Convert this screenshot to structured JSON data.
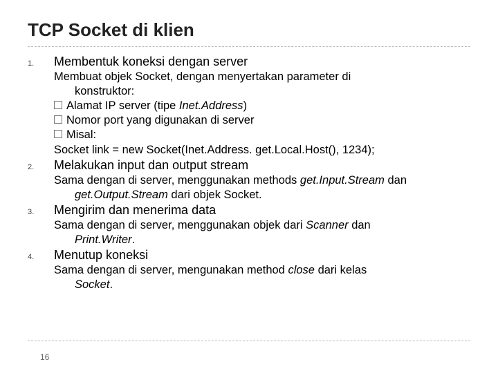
{
  "title": "TCP Socket di klien",
  "items": [
    {
      "num": "1.",
      "head": "Membentuk koneksi dengan server",
      "body_intro": "Membuat objek Socket, dengan menyertakan parameter di",
      "body_intro_cont": "konstruktor:",
      "checks": [
        {
          "pre": "Alamat IP server (tipe ",
          "it": "Inet.Address",
          "post": ")"
        },
        {
          "pre": "Nomor port yang digunakan di server",
          "it": "",
          "post": ""
        },
        {
          "pre": "Misal:",
          "it": "",
          "post": ""
        }
      ],
      "code": "Socket link = new Socket(Inet.Address. get.Local.Host(), 1234);"
    },
    {
      "num": "2.",
      "head": "Melakukan input dan output stream",
      "body_intro": "Sama dengan di server, menggunakan methods ",
      "body_it1": "get.Input.Stream",
      "body_mid": " dan",
      "body_cont_it": "get.Output.Stream",
      "body_cont_post": " dari objek Socket."
    },
    {
      "num": "3.",
      "head": "Mengirim dan menerima data",
      "body_intro": "Sama dengan di server, menggunakan objek dari ",
      "body_it1": "Scanner",
      "body_mid": " dan",
      "body_cont_it": "Print.Writer",
      "body_cont_post": "."
    },
    {
      "num": "4.",
      "head": "Menutup koneksi",
      "body_intro": "Sama dengan di server, mengunakan method ",
      "body_it1": "close",
      "body_mid": " dari kelas",
      "body_cont_it": "Socket",
      "body_cont_post": "."
    }
  ],
  "page_number": "16"
}
